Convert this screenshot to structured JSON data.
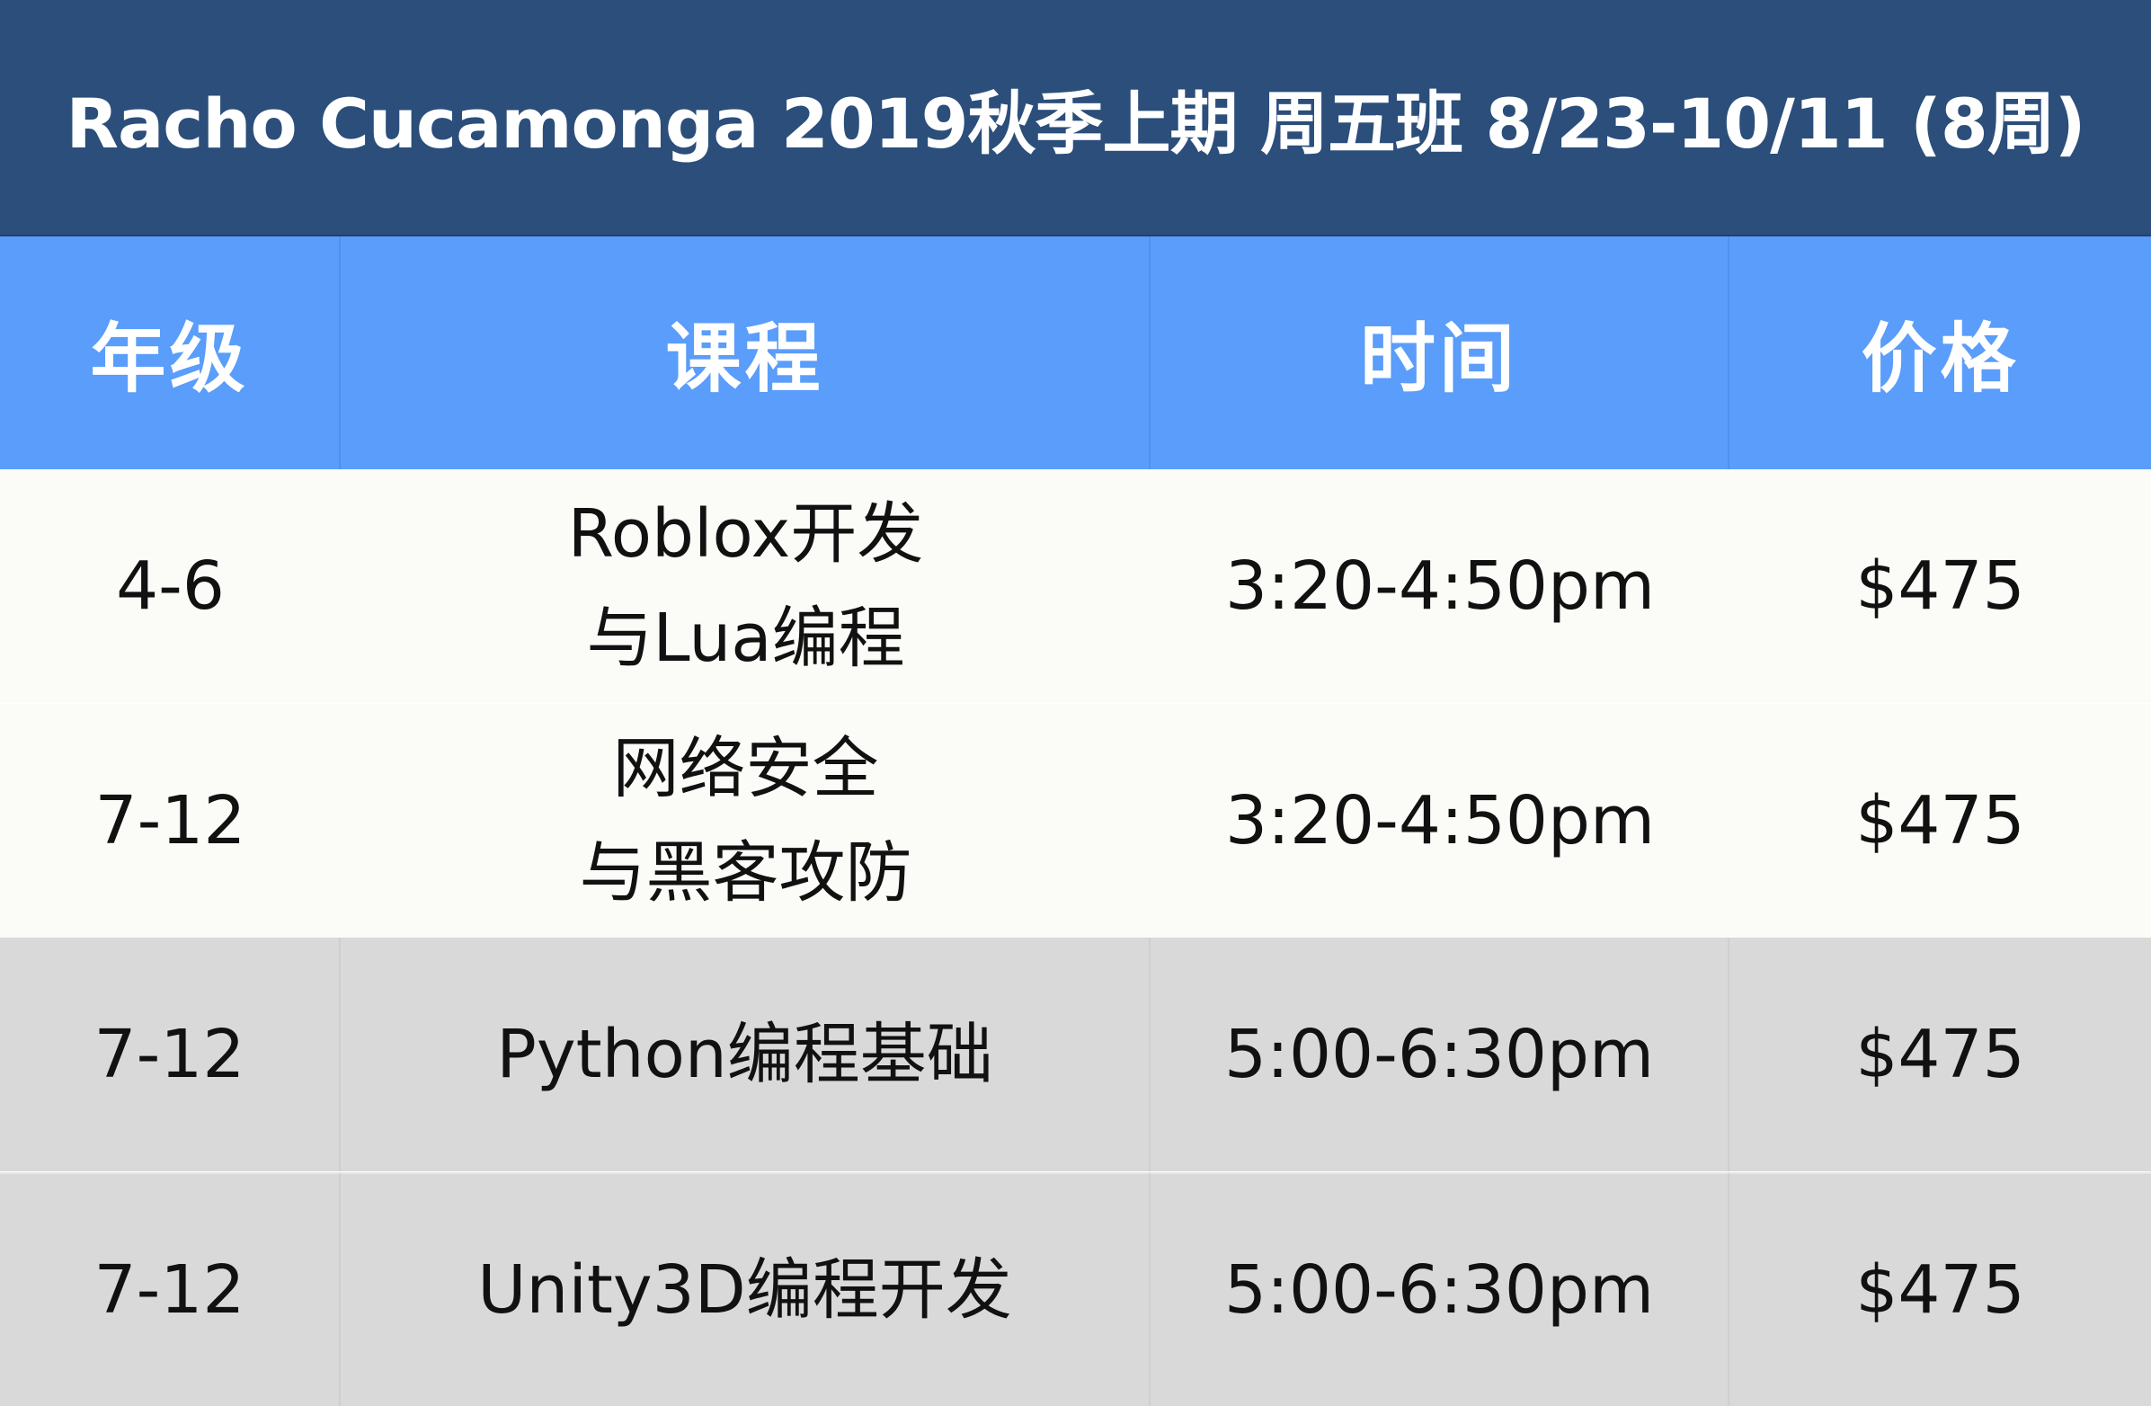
{
  "title": "Racho Cucamonga 2019秋季上期 周五班 8/23-10/11 (8周)",
  "columns": {
    "grade": "年级",
    "course": "课程",
    "time": "时间",
    "price": "价格"
  },
  "rows": [
    {
      "grade": "4-6",
      "course_line1": "Roblox开发",
      "course_line2": "与Lua编程",
      "time": "3:20-4:50pm",
      "price": "$475"
    },
    {
      "grade": "7-12",
      "course_line1": "网络安全",
      "course_line2": "与黑客攻防",
      "time": "3:20-4:50pm",
      "price": "$475"
    },
    {
      "grade": "7-12",
      "course_line1": "Python编程基础",
      "course_line2": "",
      "time": "5:00-6:30pm",
      "price": "$475"
    },
    {
      "grade": "7-12",
      "course_line1": "Unity3D编程开发",
      "course_line2": "",
      "time": "5:00-6:30pm",
      "price": "$475"
    }
  ],
  "colors": {
    "title_bg": "#2b4e7b",
    "header_bg": "#5a9dfa",
    "light_row_bg": "#fbfbf8",
    "dark_row_bg": "#d9d9d9"
  }
}
